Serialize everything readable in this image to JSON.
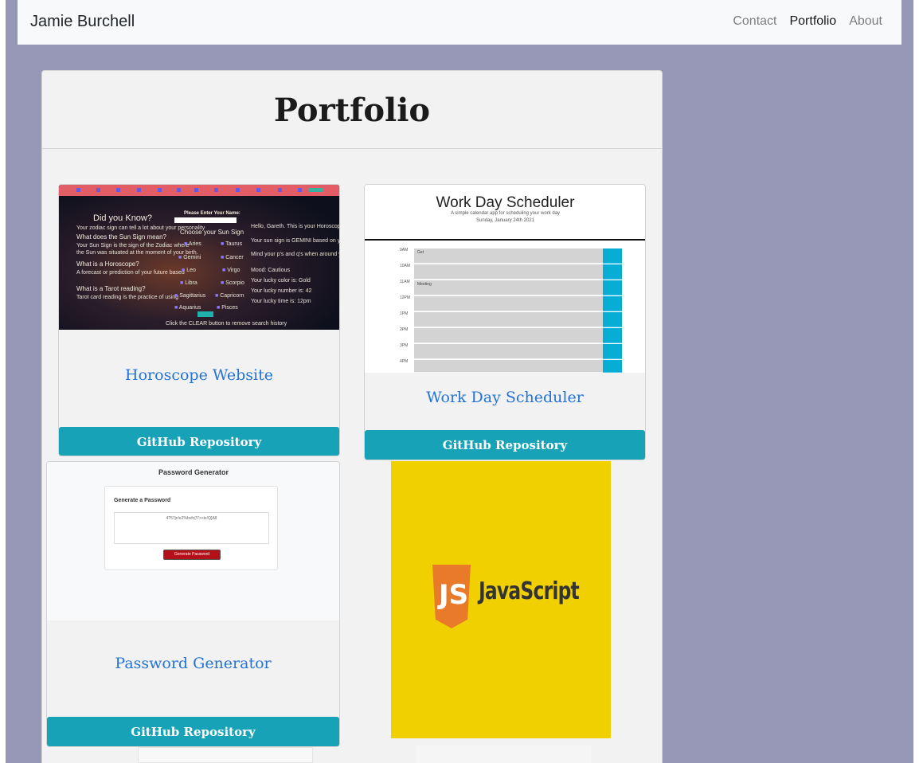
{
  "navbar": {
    "brand": "Jamie Burchell",
    "links": [
      {
        "label": "Contact",
        "active": false
      },
      {
        "label": "Portfolio",
        "active": true
      },
      {
        "label": "About",
        "active": false
      }
    ]
  },
  "page": {
    "title": "Portfolio"
  },
  "projects": [
    {
      "title": "Horoscope Website",
      "button": "GitHub Repository"
    },
    {
      "title": "Work Day Scheduler",
      "button": "GitHub Repository"
    },
    {
      "title": "Password Generator",
      "button": "GitHub Repository"
    }
  ],
  "thumbnails": {
    "horoscope": {
      "heading_know": "Did you Know?",
      "heading_sun": "What does the Sun Sign mean?",
      "heading_horoscope": "What is a Horoscope?",
      "heading_tarot": "What is a Tarot reading?",
      "name_prompt": "Please Enter Your Name:",
      "choose_sign": "Choose your Sun Sign",
      "signs": [
        "Aries",
        "Taurus",
        "Gemini",
        "Cancer",
        "Leo",
        "Virgo",
        "Libra",
        "Scorpio",
        "Sagittarius",
        "Capricorn",
        "Aquarius",
        "Pisces"
      ]
    },
    "workday": {
      "title": "Work Day Scheduler",
      "subtitle": "A simple calendar app for scheduling your work day",
      "date": "Sunday, January 24th 2021",
      "hours": [
        "9AM",
        "10AM",
        "11AM",
        "12PM",
        "1PM",
        "2PM",
        "3PM",
        "4PM"
      ]
    },
    "password": {
      "title": "Password Generator",
      "card_heading": "Generate a Password",
      "generated": "4?57jn!e2%bvfc{!7><ts!Q]A8",
      "button": "Generate Password"
    },
    "javascript": {
      "shield": "JS",
      "word": "JavaScript"
    }
  },
  "colors": {
    "background": "#9797b7",
    "accent_button": "#17a2b8",
    "link": "#2374d6"
  }
}
